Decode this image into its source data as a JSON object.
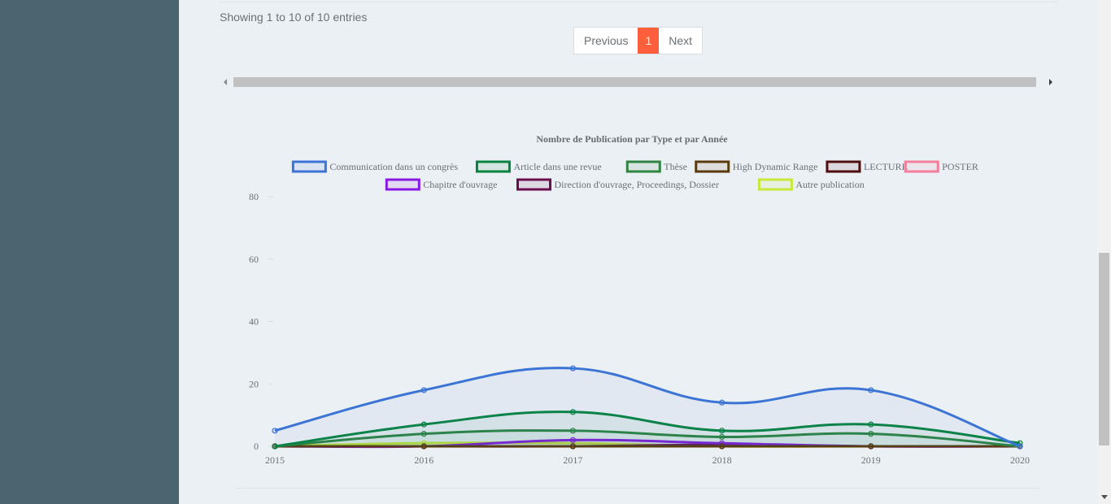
{
  "table": {
    "info": "Showing 1 to 10 of 10 entries"
  },
  "pagination": {
    "previous": "Previous",
    "current": "1",
    "next": "Next"
  },
  "colors": {
    "sidebar": "#4b6570",
    "accent": "#fd5e3b",
    "background": "#ebf0f4"
  },
  "chart_data": {
    "type": "line",
    "title": "Nombre de Publication par Type et par Année",
    "x": [
      "2015",
      "2016",
      "2017",
      "2018",
      "2019",
      "2020"
    ],
    "ylim": [
      0,
      80
    ],
    "yticks": [
      0,
      20,
      40,
      60,
      80
    ],
    "grid": false,
    "legend_position": "top",
    "series": [
      {
        "name": "Communication dans un congrès",
        "color": "#3c74d6",
        "values": [
          5,
          18,
          25,
          14,
          18,
          0
        ]
      },
      {
        "name": "Article dans une revue",
        "color": "#08833f",
        "values": [
          0,
          7,
          11,
          5,
          7,
          1
        ]
      },
      {
        "name": "Thèse",
        "color": "#2e8440",
        "values": [
          0,
          4,
          5,
          3,
          4,
          0
        ]
      },
      {
        "name": "High Dynamic Range",
        "color": "#5a3a0c",
        "values": [
          0,
          0,
          0,
          0,
          0,
          0
        ]
      },
      {
        "name": "LECTURE",
        "color": "#4f0d10",
        "values": [
          0,
          0,
          0,
          0,
          0,
          0
        ]
      },
      {
        "name": "POSTER",
        "color": "#f27f9b",
        "values": [
          0,
          0,
          0,
          0,
          0,
          0
        ]
      },
      {
        "name": "Chapitre d'ouvrage",
        "color": "#8719e3",
        "values": [
          0,
          0,
          2,
          1,
          0,
          0
        ]
      },
      {
        "name": "Direction d'ouvrage, Proceedings, Dossier",
        "color": "#6b0e4e",
        "values": [
          0,
          0,
          0,
          0.5,
          0,
          0
        ]
      },
      {
        "name": "Autre publication",
        "color": "#c8e83a",
        "values": [
          0,
          1,
          1,
          0,
          0,
          0
        ]
      }
    ]
  }
}
